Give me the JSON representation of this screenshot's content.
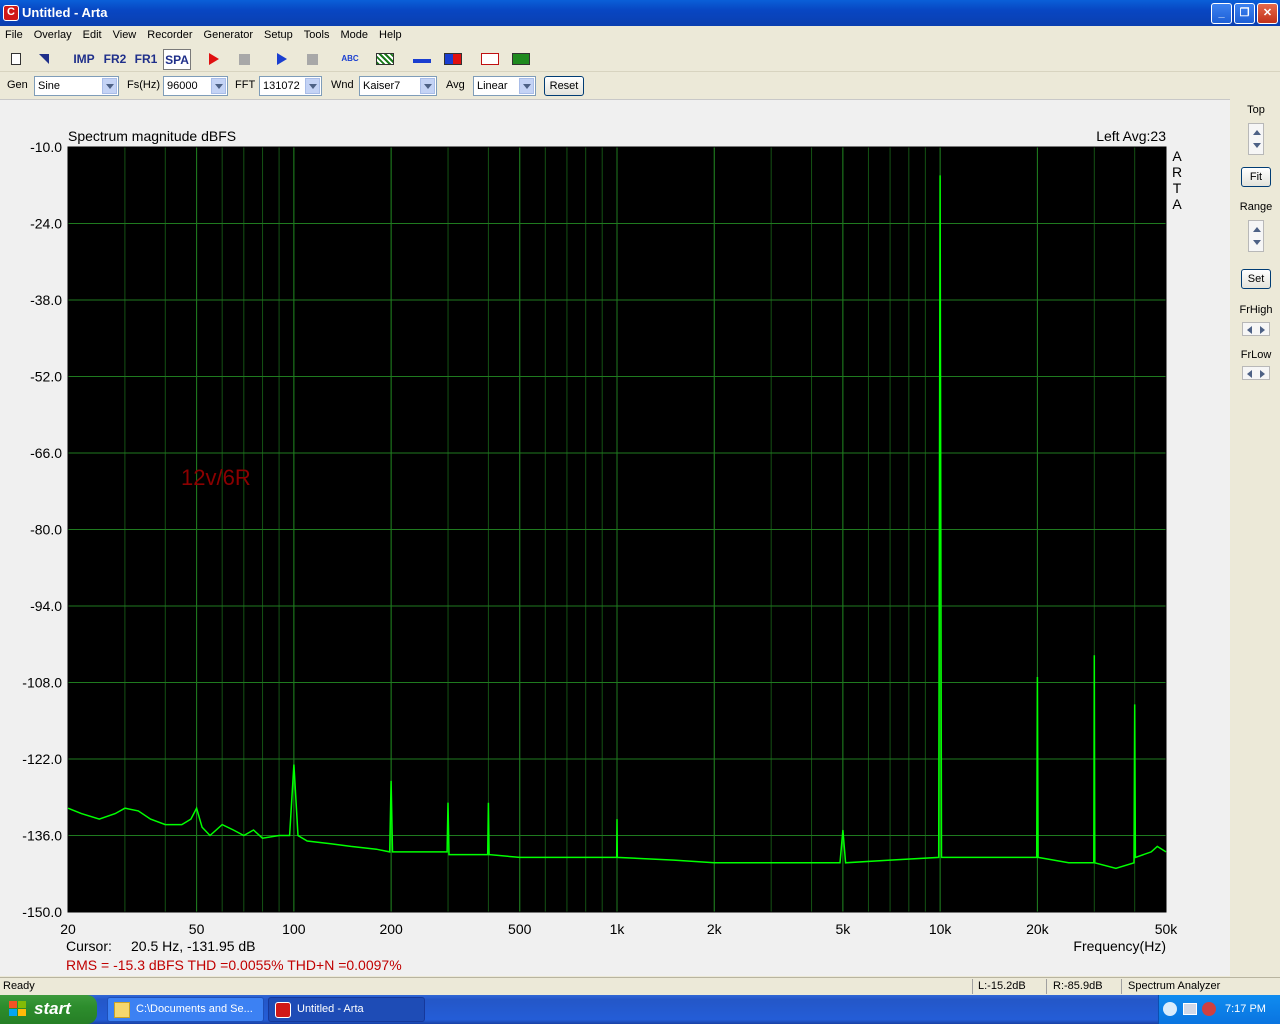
{
  "window": {
    "title": "Untitled - Arta"
  },
  "title_buttons": {
    "minimize": "_",
    "restore": "❐",
    "close": "✕"
  },
  "menu": [
    "File",
    "Overlay",
    "Edit",
    "View",
    "Recorder",
    "Generator",
    "Setup",
    "Tools",
    "Mode",
    "Help"
  ],
  "toolbar": {
    "imp": "IMP",
    "fr2": "FR2",
    "fr1": "FR1",
    "spa": "SPA",
    "abc": "ABC"
  },
  "settings": {
    "gen_label": "Gen",
    "gen_value": "Sine",
    "fs_label": "Fs(Hz)",
    "fs_value": "96000",
    "fft_label": "FFT",
    "fft_value": "131072",
    "wnd_label": "Wnd",
    "wnd_value": "Kaiser7",
    "avg_label": "Avg",
    "avg_value": "Linear",
    "reset_label": "Reset"
  },
  "right_panel": {
    "top": "Top",
    "fit": "Fit",
    "range": "Range",
    "set": "Set",
    "frhigh": "FrHigh",
    "frlow": "FrLow"
  },
  "status": {
    "ready": "Ready",
    "left_level": "L:-15.2dB",
    "right_level": "R:-85.9dB",
    "mode": "Spectrum Analyzer"
  },
  "taskbar": {
    "start": "start",
    "task1": "C:\\Documents and Se...",
    "task2": "Untitled - Arta",
    "clock": "7:17 PM"
  },
  "colors": {
    "trace": "#00ff00",
    "grid": "#1f7a1f",
    "background": "#000000",
    "annotation": "#8b0000",
    "readout": "#c00000"
  },
  "chart_data": {
    "type": "line",
    "title": "Spectrum magnitude dBFS",
    "channel_info": "Left  Avg:23",
    "watermark": "ARTA",
    "annotation": "12v/6R",
    "xlabel": "Frequency(Hz)",
    "x_scale": "log",
    "xlim": [
      20,
      50000
    ],
    "ylim": [
      -150,
      -10
    ],
    "x_ticks": [
      {
        "v": 20,
        "label": "20"
      },
      {
        "v": 50,
        "label": "50"
      },
      {
        "v": 100,
        "label": "100"
      },
      {
        "v": 200,
        "label": "200"
      },
      {
        "v": 500,
        "label": "500"
      },
      {
        "v": 1000,
        "label": "1k"
      },
      {
        "v": 2000,
        "label": "2k"
      },
      {
        "v": 5000,
        "label": "5k"
      },
      {
        "v": 10000,
        "label": "10k"
      },
      {
        "v": 20000,
        "label": "20k"
      },
      {
        "v": 50000,
        "label": "50k"
      }
    ],
    "y_ticks": [
      "-10.0",
      "-24.0",
      "-38.0",
      "-52.0",
      "-66.0",
      "-80.0",
      "-94.0",
      "-108.0",
      "-122.0",
      "-136.0",
      "-150.0"
    ],
    "series": [
      {
        "values": [
          {
            "x": 20,
            "y": -131
          },
          {
            "x": 22,
            "y": -132
          },
          {
            "x": 25,
            "y": -133
          },
          {
            "x": 28,
            "y": -132
          },
          {
            "x": 30,
            "y": -131
          },
          {
            "x": 33,
            "y": -131.5
          },
          {
            "x": 36,
            "y": -133
          },
          {
            "x": 40,
            "y": -134
          },
          {
            "x": 45,
            "y": -134
          },
          {
            "x": 48,
            "y": -133
          },
          {
            "x": 50,
            "y": -131
          },
          {
            "x": 52,
            "y": -134.5
          },
          {
            "x": 55,
            "y": -136
          },
          {
            "x": 60,
            "y": -134
          },
          {
            "x": 65,
            "y": -135
          },
          {
            "x": 70,
            "y": -136
          },
          {
            "x": 75,
            "y": -135
          },
          {
            "x": 80,
            "y": -136.5
          },
          {
            "x": 90,
            "y": -136
          },
          {
            "x": 97,
            "y": -136
          },
          {
            "x": 100,
            "y": -123
          },
          {
            "x": 103,
            "y": -136
          },
          {
            "x": 110,
            "y": -137
          },
          {
            "x": 130,
            "y": -137.5
          },
          {
            "x": 150,
            "y": -138
          },
          {
            "x": 180,
            "y": -138.5
          },
          {
            "x": 198,
            "y": -139
          },
          {
            "x": 200,
            "y": -126
          },
          {
            "x": 202,
            "y": -139
          },
          {
            "x": 250,
            "y": -139
          },
          {
            "x": 298,
            "y": -139
          },
          {
            "x": 300,
            "y": -130
          },
          {
            "x": 302,
            "y": -139.5
          },
          {
            "x": 350,
            "y": -139.5
          },
          {
            "x": 398,
            "y": -139.5
          },
          {
            "x": 400,
            "y": -130
          },
          {
            "x": 402,
            "y": -139.5
          },
          {
            "x": 500,
            "y": -140
          },
          {
            "x": 700,
            "y": -140
          },
          {
            "x": 998,
            "y": -140
          },
          {
            "x": 1000,
            "y": -133
          },
          {
            "x": 1002,
            "y": -140
          },
          {
            "x": 1500,
            "y": -140.5
          },
          {
            "x": 2000,
            "y": -141
          },
          {
            "x": 3000,
            "y": -141
          },
          {
            "x": 4900,
            "y": -141
          },
          {
            "x": 5000,
            "y": -135
          },
          {
            "x": 5100,
            "y": -141
          },
          {
            "x": 7000,
            "y": -140.5
          },
          {
            "x": 9900,
            "y": -140
          },
          {
            "x": 10000,
            "y": -15.2
          },
          {
            "x": 10100,
            "y": -140
          },
          {
            "x": 12000,
            "y": -140
          },
          {
            "x": 15000,
            "y": -140
          },
          {
            "x": 17000,
            "y": -140
          },
          {
            "x": 19900,
            "y": -140
          },
          {
            "x": 20000,
            "y": -107
          },
          {
            "x": 20100,
            "y": -140
          },
          {
            "x": 25000,
            "y": -141
          },
          {
            "x": 29900,
            "y": -141
          },
          {
            "x": 30000,
            "y": -103
          },
          {
            "x": 30100,
            "y": -141
          },
          {
            "x": 35000,
            "y": -142
          },
          {
            "x": 39800,
            "y": -141
          },
          {
            "x": 40000,
            "y": -112
          },
          {
            "x": 40200,
            "y": -140
          },
          {
            "x": 45000,
            "y": -139
          },
          {
            "x": 47000,
            "y": -138
          },
          {
            "x": 50000,
            "y": -139
          }
        ]
      }
    ],
    "cursor_label": "Cursor:",
    "cursor_value": "20.5 Hz, -131.95 dB",
    "readout": "RMS =  -15.3 dBFS   THD =0.0055%   THD+N =0.0097%"
  }
}
